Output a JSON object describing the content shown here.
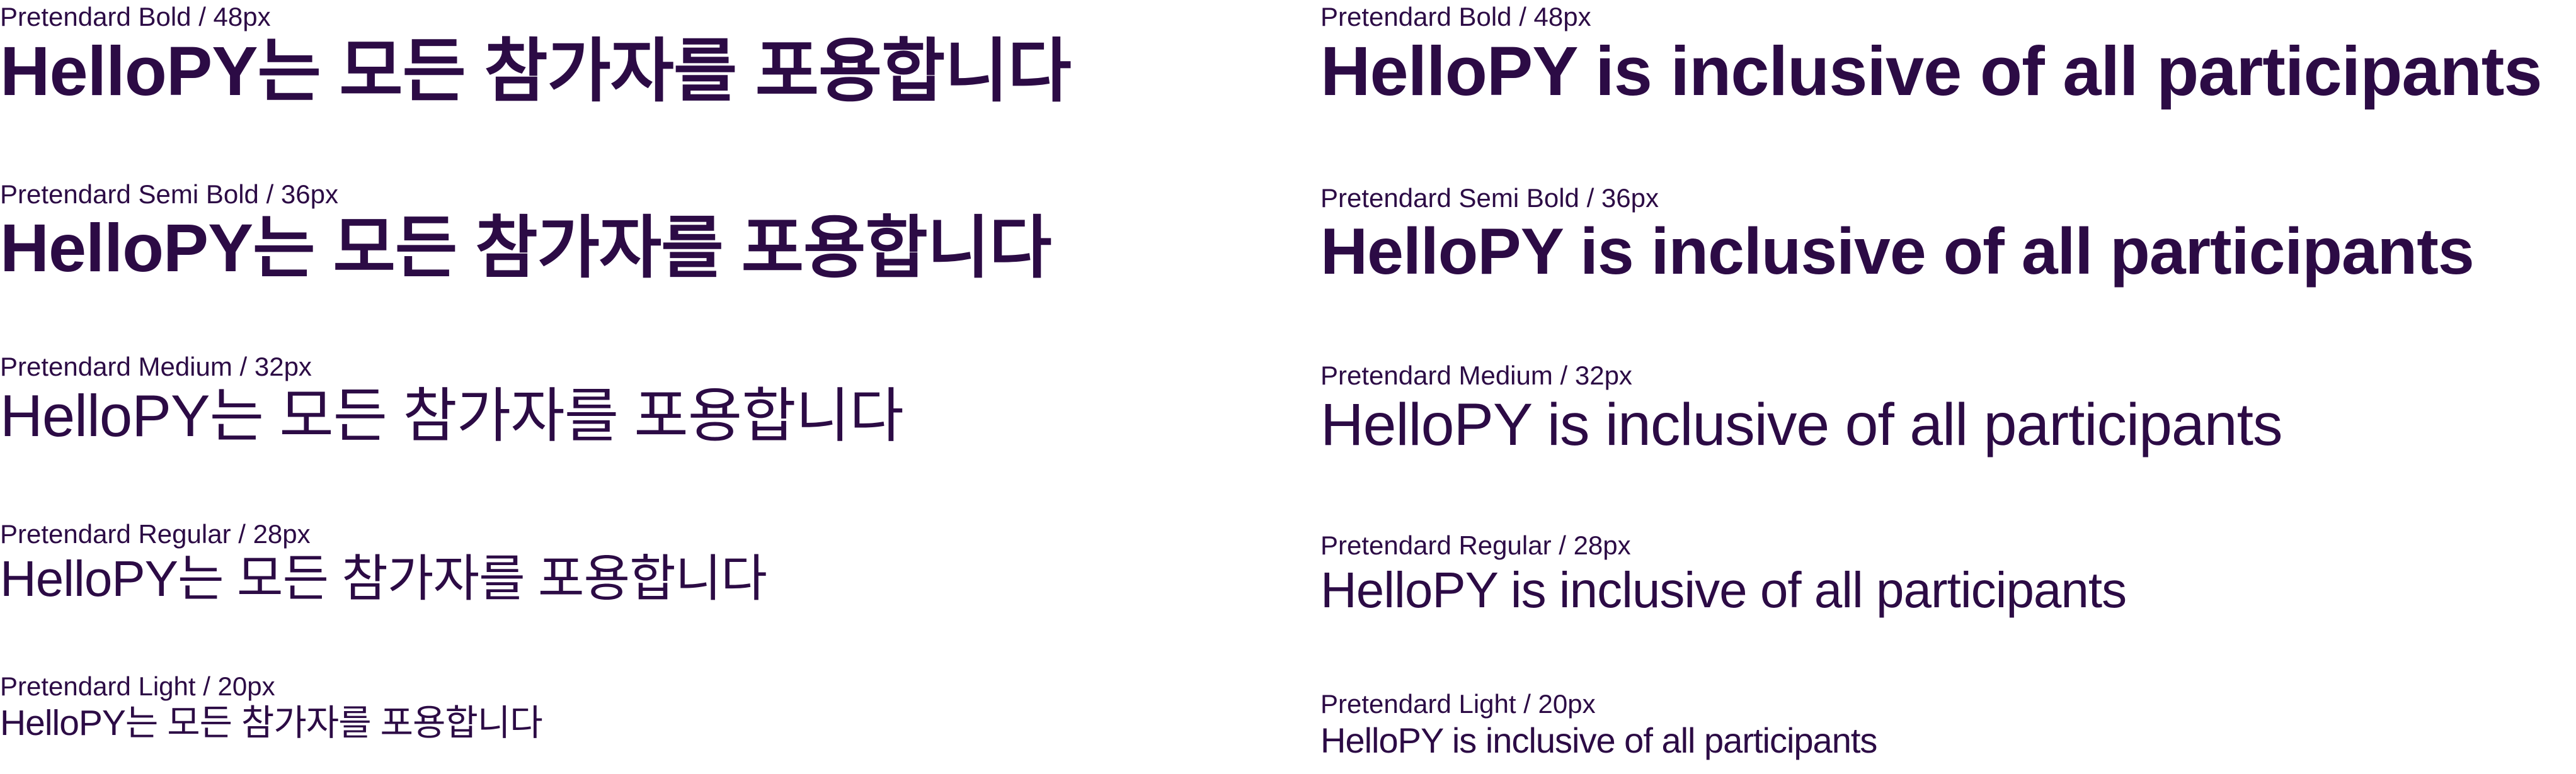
{
  "colors": {
    "text": "#2c0b45",
    "background": "#ffffff"
  },
  "korean_specimens": [
    {
      "label": "Pretendard Bold /  48px",
      "sample": "HelloPY는 모든 참가자를 포용합니다"
    },
    {
      "label": "Pretendard Semi Bold / 36px",
      "sample": "HelloPY는 모든 참가자를 포용합니다"
    },
    {
      "label": "Pretendard Medium /  32px",
      "sample": "HelloPY는 모든 참가자를 포용합니다"
    },
    {
      "label": "Pretendard Regular / 28px",
      "sample": "HelloPY는 모든 참가자를 포용합니다"
    },
    {
      "label": "Pretendard Light /  20px",
      "sample": "HelloPY는 모든 참가자를 포용합니다"
    }
  ],
  "english_specimens": [
    {
      "label": "Pretendard Bold /  48px",
      "sample": "HelloPY is inclusive of all participants"
    },
    {
      "label": "Pretendard Semi Bold / 36px",
      "sample": "HelloPY is inclusive of all participants"
    },
    {
      "label": "Pretendard Medium /  32px",
      "sample": "HelloPY is inclusive of all participants"
    },
    {
      "label": "Pretendard Regular / 28px",
      "sample": "HelloPY is inclusive of all participants"
    },
    {
      "label": "Pretendard Light /  20px",
      "sample": "HelloPY is inclusive of all participants"
    }
  ]
}
